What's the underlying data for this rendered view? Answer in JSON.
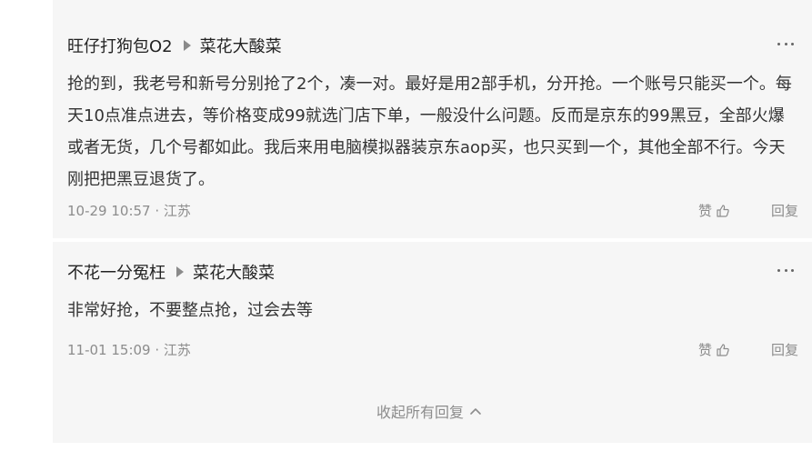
{
  "comments": [
    {
      "author": "旺仔打狗包O2",
      "reply_to": "菜花大酸菜",
      "content": "抢的到，我老号和新号分别抢了2个，凑一对。最好是用2部手机，分开抢。一个账号只能买一个。每天10点准点进去，等价格变成99就选门店下单，一般没什么问题。反而是京东的99黑豆，全部火爆或者无货，几个号都如此。我后来用电脑模拟器装京东aop买，也只买到一个，其他全部不行。今天刚把把黑豆退货了。",
      "time": "10-29 10:57 · 江苏",
      "like_label": "赞",
      "reply_label": "回复"
    },
    {
      "author": "不花一分冤枉",
      "reply_to": "菜花大酸菜",
      "content": "非常好抢，不要整点抢，过会去等",
      "time": "11-01 15:09 · 江苏",
      "like_label": "赞",
      "reply_label": "回复"
    }
  ],
  "collapse_label": "收起所有回复",
  "icons": {
    "reply_arrow": "triangle-right-icon",
    "more": "more-dots-icon",
    "like": "thumb-up-icon",
    "collapse": "chevron-up-icon"
  },
  "colors": {
    "panel_bg": "#f6f6f6",
    "text": "#333333",
    "meta": "#8c8c8c"
  }
}
